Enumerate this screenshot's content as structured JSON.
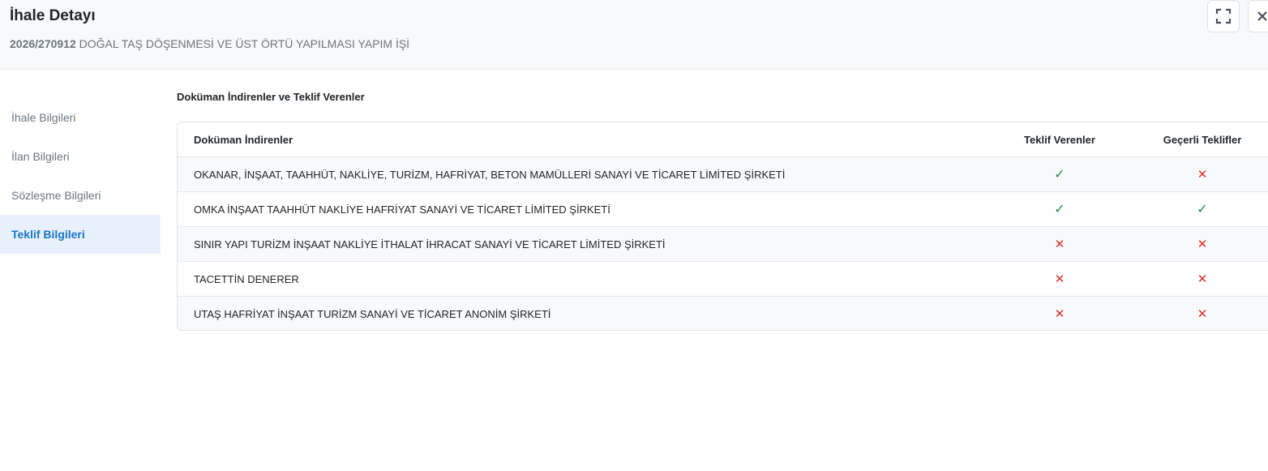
{
  "header": {
    "title": "İhale Detayı",
    "reference": "2026/270912",
    "subject": "DOĞAL TAŞ DÖŞENMESİ VE ÜST ÖRTÜ YAPILMASI YAPIM İŞİ",
    "expand_icon": "fullscreen-icon",
    "close_icon": "close-icon"
  },
  "sidebar": {
    "items": [
      {
        "label": "İhale Bilgileri",
        "active": false
      },
      {
        "label": "İlan Bilgileri",
        "active": false
      },
      {
        "label": "Sözleşme Bilgileri",
        "active": false
      },
      {
        "label": "Teklif Bilgileri",
        "active": true
      }
    ]
  },
  "main": {
    "section_title": "Doküman İndirenler ve Teklif Verenler",
    "columns": [
      "Doküman İndirenler",
      "Teklif Verenler",
      "Geçerli Teklifler"
    ],
    "rows": [
      {
        "name": "OKANAR, İNŞAAT, TAAHHÜT, NAKLİYE, TURİZM, HAFRİYAT, BETON MAMÜLLERİ SANAYİ VE TİCARET LİMİTED ŞİRKETİ",
        "teklif_veren": "✓",
        "gecerli": "✕"
      },
      {
        "name": "OMKA İNŞAAT TAAHHÜT NAKLİYE HAFRİYAT SANAYİ VE TİCARET LİMİTED ŞİRKETİ",
        "teklif_veren": "✓",
        "gecerli": "✓"
      },
      {
        "name": "SINIR YAPI TURİZM İNŞAAT NAKLİYE İTHALAT İHRACAT SANAYİ VE TİCARET LİMİTED ŞİRKETİ",
        "teklif_veren": "✕",
        "gecerli": "✕"
      },
      {
        "name": "TACETTİN DENERER",
        "teklif_veren": "✕",
        "gecerli": "✕"
      },
      {
        "name": "UTAŞ HAFRİYAT İNŞAAT TURİZM SANAYİ VE TİCARET ANONİM ŞİRKETİ",
        "teklif_veren": "✕",
        "gecerli": "✕"
      }
    ]
  },
  "colors": {
    "accent": "#1a73c8",
    "active_bg": "#e8f1fb",
    "yes": "#1e8e3e",
    "no": "#d93025"
  }
}
